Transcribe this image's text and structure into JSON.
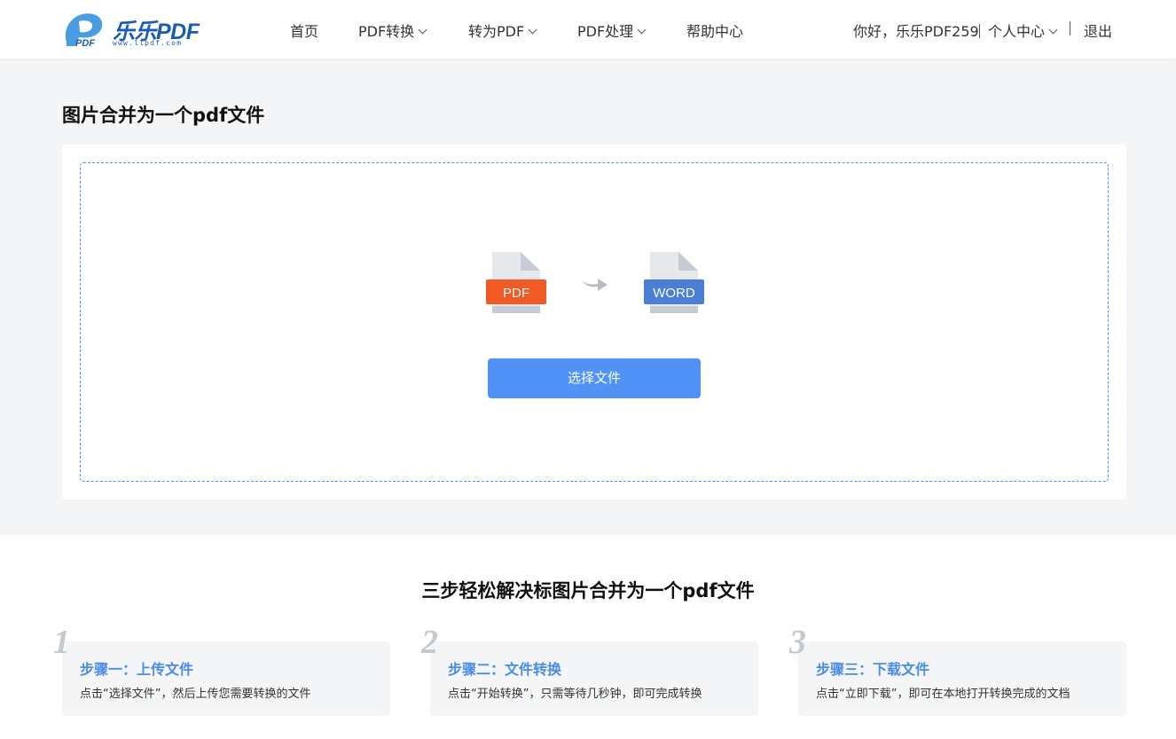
{
  "brand": {
    "logo_text": "乐乐PDF",
    "logo_url": "www.llpdf.com",
    "logo_mark": "PDF",
    "color": "#1a5bb8"
  },
  "nav": {
    "items": [
      {
        "label": "首页",
        "has_dropdown": false
      },
      {
        "label": "PDF转换",
        "has_dropdown": true
      },
      {
        "label": "转为PDF",
        "has_dropdown": true
      },
      {
        "label": "PDF处理",
        "has_dropdown": true
      },
      {
        "label": "帮助中心",
        "has_dropdown": false
      }
    ]
  },
  "user": {
    "greeting": "你好，乐乐PDF259",
    "center_label": "个人中心",
    "logout_label": "退出"
  },
  "main": {
    "title": "图片合并为一个pdf文件",
    "icons": {
      "from": {
        "name": "pdf-file-icon",
        "label": "PDF",
        "color": "#f05a24"
      },
      "arrow": "arrow-right-icon",
      "to": {
        "name": "word-file-icon",
        "label": "WORD",
        "color": "#4b7fd6"
      }
    },
    "select_button": "选择文件",
    "accent": "#5092f5"
  },
  "steps": {
    "title": "三步轻松解决标图片合并为一个pdf文件",
    "items": [
      {
        "num": "1",
        "title": "步骤一：上传文件",
        "desc": "点击“选择文件”，然后上传您需要转换的文件"
      },
      {
        "num": "2",
        "title": "步骤二：文件转换",
        "desc": "点击“开始转换”，只需等待几秒钟，即可完成转换"
      },
      {
        "num": "3",
        "title": "步骤三：下载文件",
        "desc": "点击“立即下载”，即可在本地打开转换完成的文档"
      }
    ]
  }
}
